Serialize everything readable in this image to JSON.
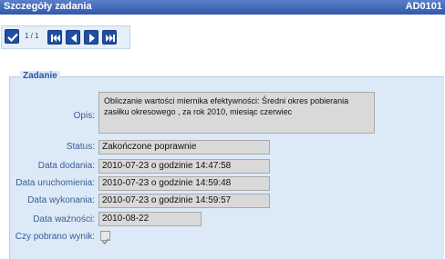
{
  "window": {
    "title": "Szczegóły zadania",
    "code": "AD0101"
  },
  "toolbar": {
    "pager": "1 / 1"
  },
  "section": {
    "title": "Zadanie"
  },
  "form": {
    "opis_label": "Opis:",
    "opis_value": "Obliczanie wartości miernika efektywności: Średni okres pobierania zasiłku okresowego , za rok 2010, miesiąc czerwiec",
    "status_label": "Status:",
    "status_value": "Zakończone poprawnie",
    "dodania_label": "Data dodania:",
    "dodania_value": "2010-07-23 o godzinie 14:47:58",
    "uruchomienia_label": "Data uruchomienia:",
    "uruchomienia_value": "2010-07-23 o godzinie 14:59:48",
    "wykonania_label": "Data wykonania:",
    "wykonania_value": "2010-07-23 o godzinie 14:59:57",
    "waznosci_label": "Data ważności:",
    "waznosci_value": "2010-08-22",
    "wynik_label": "Czy pobrano wynik:",
    "wynik_checked": true
  }
}
